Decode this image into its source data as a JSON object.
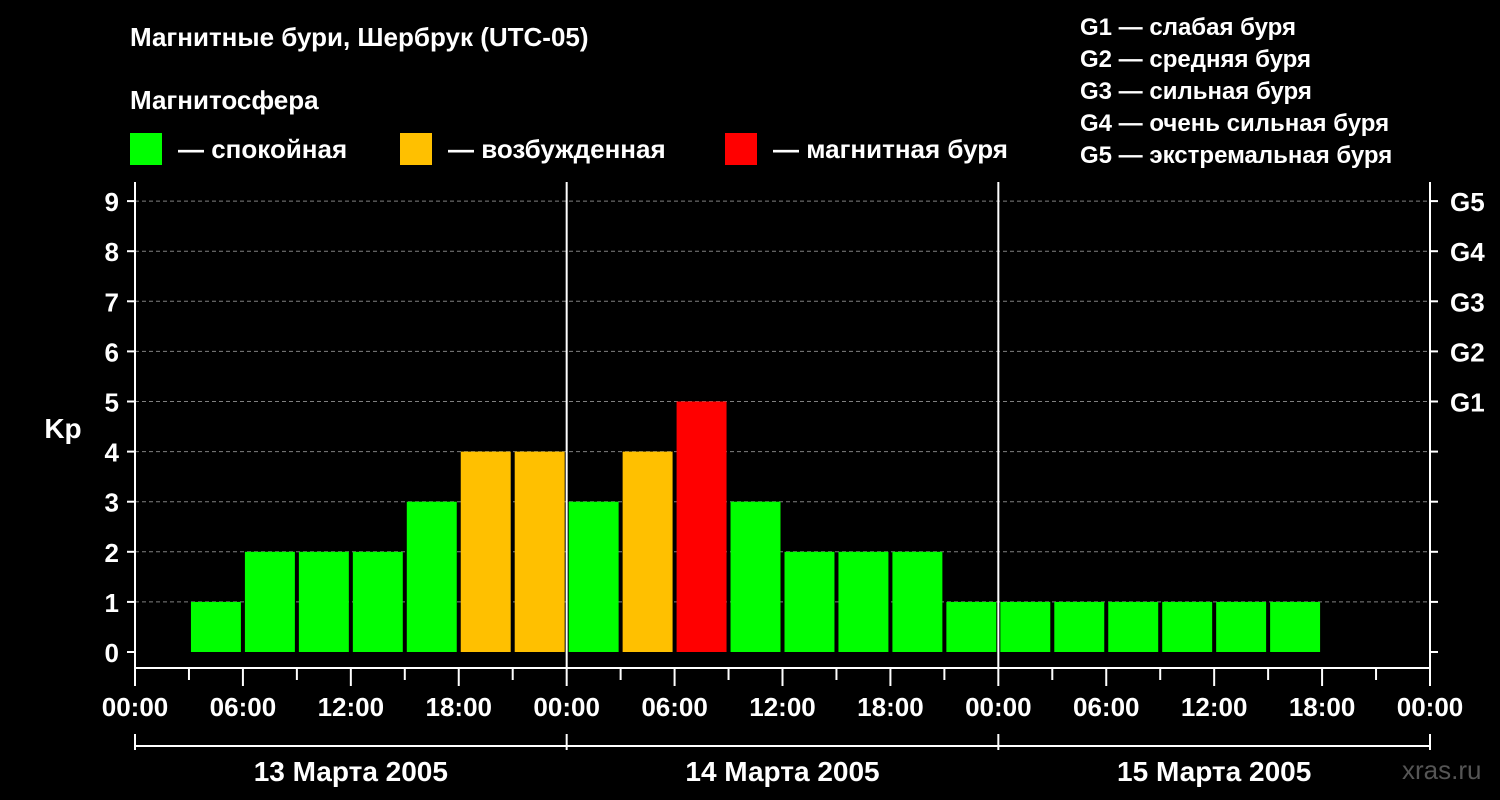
{
  "chart_data": {
    "type": "bar",
    "title": "Магнитные бури, Шербрук (UTC-05)",
    "ylabel": "Kp",
    "ylim": [
      0,
      9
    ],
    "y_ticks": [
      "0",
      "1",
      "2",
      "3",
      "4",
      "5",
      "6",
      "7",
      "8",
      "9"
    ],
    "storm_levels": [
      {
        "kp": 5,
        "label": "G1"
      },
      {
        "kp": 6,
        "label": "G2"
      },
      {
        "kp": 7,
        "label": "G3"
      },
      {
        "kp": 8,
        "label": "G4"
      },
      {
        "kp": 9,
        "label": "G5"
      }
    ],
    "x_tick_labels": [
      "00:00",
      "06:00",
      "12:00",
      "18:00",
      "00:00",
      "06:00",
      "12:00",
      "18:00",
      "00:00",
      "06:00",
      "12:00",
      "18:00",
      "00:00"
    ],
    "days": [
      "13 Марта 2005",
      "14 Марта 2005",
      "15 Марта 2005"
    ],
    "interval_hours": 3,
    "values": [
      null,
      1,
      2,
      2,
      2,
      3,
      4,
      4,
      3,
      4,
      5,
      3,
      2,
      2,
      2,
      1,
      1,
      1,
      1,
      1,
      1,
      1,
      null,
      null
    ],
    "levels": [
      "",
      "quiet",
      "quiet",
      "quiet",
      "quiet",
      "quiet",
      "active",
      "active",
      "quiet",
      "active",
      "storm",
      "quiet",
      "quiet",
      "quiet",
      "quiet",
      "quiet",
      "quiet",
      "quiet",
      "quiet",
      "quiet",
      "quiet",
      "quiet",
      "",
      ""
    ],
    "colors": {
      "quiet": "#00ff00",
      "active": "#ffc000",
      "storm": "#ff0000"
    },
    "grid": true
  },
  "legend": {
    "title": "Магнитосфера",
    "items": [
      {
        "key": "quiet",
        "label": "— спокойная",
        "color": "#00ff00"
      },
      {
        "key": "active",
        "label": "— возбужденная",
        "color": "#ffc000"
      },
      {
        "key": "storm",
        "label": "— магнитная буря",
        "color": "#ff0000"
      }
    ]
  },
  "g_scale": [
    "G1 — слабая буря",
    "G2 — средняя буря",
    "G3 — сильная буря",
    "G4 — очень сильная буря",
    "G5 — экстремальная буря"
  ],
  "watermark": "xras.ru"
}
